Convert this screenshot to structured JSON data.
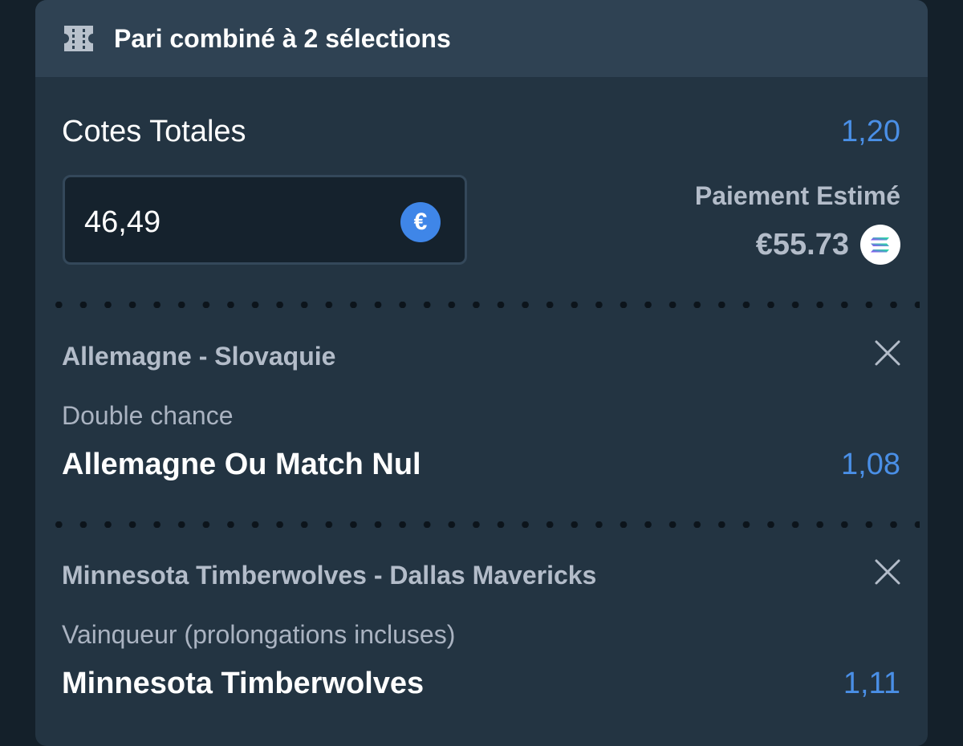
{
  "header": {
    "title": "Pari combiné à 2 sélections",
    "icon": "ticket-icon"
  },
  "totals": {
    "label": "Cotes Totales",
    "value": "1,20"
  },
  "stake": {
    "value": "46,49",
    "currency_icon": "euro-icon",
    "currency_symbol": "€"
  },
  "payout": {
    "label": "Paiement Estimé",
    "value": "€55.73",
    "token_icon": "solana-icon"
  },
  "selections": [
    {
      "match": "Allemagne - Slovaquie",
      "market": "Double chance",
      "pick": "Allemagne Ou Match Nul",
      "odds": "1,08"
    },
    {
      "match": "Minnesota Timberwolves - Dallas Mavericks",
      "market": "Vainqueur (prolongations incluses)",
      "pick": "Minnesota Timberwolves",
      "odds": "1,11"
    }
  ],
  "colors": {
    "accent": "#4a8fe6",
    "card_bg": "#233442",
    "header_bg": "#2f4253",
    "muted_text": "#b3bcc9"
  }
}
